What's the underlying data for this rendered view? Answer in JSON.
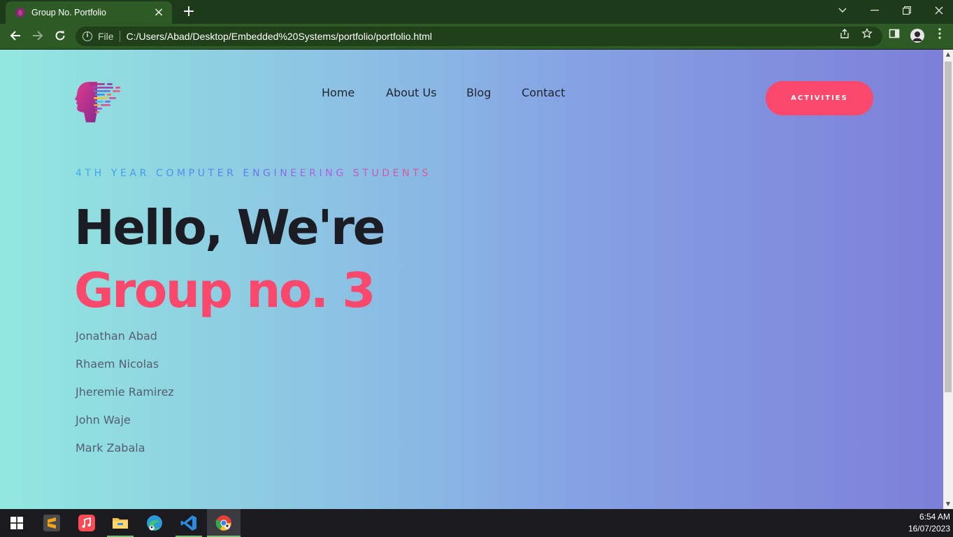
{
  "browser": {
    "tab_title": "Group No. Portfolio",
    "tab_close": "×",
    "new_tab": "+",
    "file_label": "File",
    "url": "C:/Users/Abad/Desktop/Embedded%20Systems/portfolio/portfolio.html",
    "icons": [
      "back-icon",
      "forward-icon",
      "reload-icon",
      "info-icon",
      "share-icon",
      "star-icon",
      "sidepanel-icon",
      "profile-icon",
      "menu-icon",
      "tab-search-icon",
      "minimize-icon",
      "restore-icon",
      "close-icon"
    ]
  },
  "page": {
    "nav": [
      "Home",
      "About Us",
      "Blog",
      "Contact"
    ],
    "cta_label": "ACTIVITIES",
    "eyebrow": "4TH YEAR COMPUTER ENGINEERING STUDENTS",
    "headline_line1": "Hello, We're",
    "headline_line2": "Group no. 3",
    "members": [
      "Jonathan Abad",
      "Rhaem Nicolas",
      "Jheremie Ramirez",
      "John Waje",
      "Mark Zabala"
    ],
    "colors": {
      "accent": "#f9486b",
      "heading": "#1c1c24",
      "gradient_start": "#92e8df",
      "gradient_end": "#7d7fd8"
    }
  },
  "taskbar": {
    "time": "6:54 AM",
    "date": "16/07/2023",
    "apps": [
      "windows-start",
      "sublime-text",
      "apple-music",
      "file-explorer",
      "microsoft-edge",
      "vs-code",
      "google-chrome"
    ]
  }
}
